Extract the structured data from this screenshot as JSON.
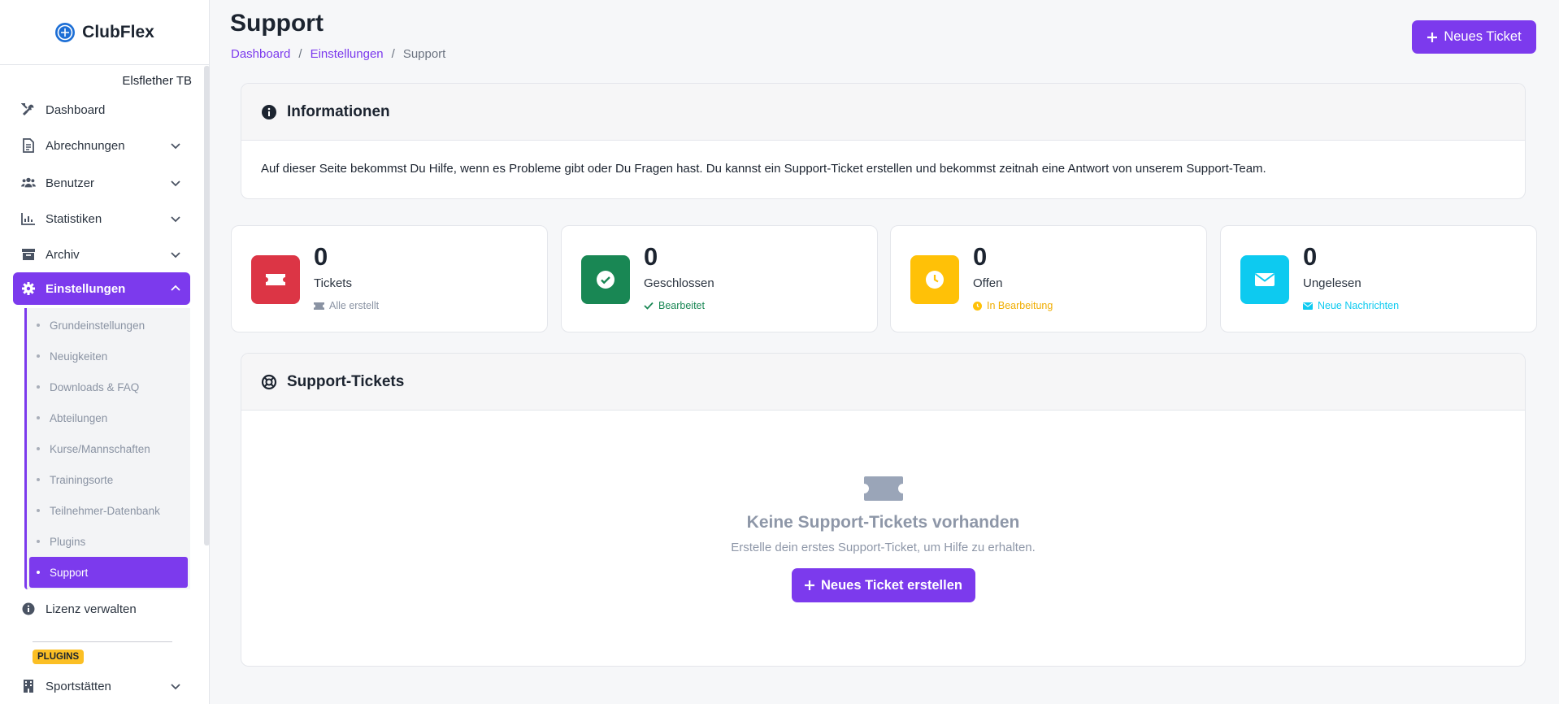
{
  "sidebar": {
    "brand": "ClubFlex",
    "club_name": "Elsflether TB",
    "items": [
      {
        "label": "Dashboard",
        "icon": "tools-icon"
      },
      {
        "label": "Abrechnungen",
        "icon": "file-invoice-icon"
      },
      {
        "label": "Benutzer",
        "icon": "users-icon"
      },
      {
        "label": "Statistiken",
        "icon": "chart-icon"
      },
      {
        "label": "Archiv",
        "icon": "archive-icon"
      },
      {
        "label": "Einstellungen",
        "icon": "gear-icon"
      }
    ],
    "subitems": [
      "Grundeinstellungen",
      "Neuigkeiten",
      "Downloads & FAQ",
      "Abteilungen",
      "Kurse/Mannschaften",
      "Trainingsorte",
      "Teilnehmer-Datenbank",
      "Plugins",
      "Support"
    ],
    "license_label": "Lizenz verwalten",
    "plugins_badge": "PLUGINS",
    "sportstaetten_label": "Sportstätten"
  },
  "header": {
    "title": "Support",
    "breadcrumb": [
      "Dashboard",
      "Einstellungen",
      "Support"
    ],
    "separator": "/",
    "new_ticket_label": "Neues Ticket"
  },
  "info": {
    "title": "Informationen",
    "text": "Auf dieser Seite bekommst Du Hilfe, wenn es Probleme gibt oder Du Fragen hast. Du kannst ein Support-Ticket erstellen und bekommst zeitnah eine Antwort von unserem Support-Team."
  },
  "stats": [
    {
      "value": "0",
      "label": "Tickets",
      "sub": "Alle erstellt",
      "color": "#dc3545",
      "sub_color": "#8a93a3"
    },
    {
      "value": "0",
      "label": "Geschlossen",
      "sub": "Bearbeitet",
      "color": "#198754",
      "sub_color": "#198754"
    },
    {
      "value": "0",
      "label": "Offen",
      "sub": "In Bearbeitung",
      "color": "#ffc107",
      "sub_color": "#f0ad00"
    },
    {
      "value": "0",
      "label": "Ungelesen",
      "sub": "Neue Nachrichten",
      "color": "#0dcaf0",
      "sub_color": "#0dcaf0"
    }
  ],
  "tickets": {
    "title": "Support-Tickets",
    "empty_title": "Keine Support-Tickets vorhanden",
    "empty_sub": "Erstelle dein erstes Support-Ticket, um Hilfe zu erhalten.",
    "create_label": "Neues Ticket erstellen"
  },
  "colors": {
    "accent": "#7c3aed"
  }
}
